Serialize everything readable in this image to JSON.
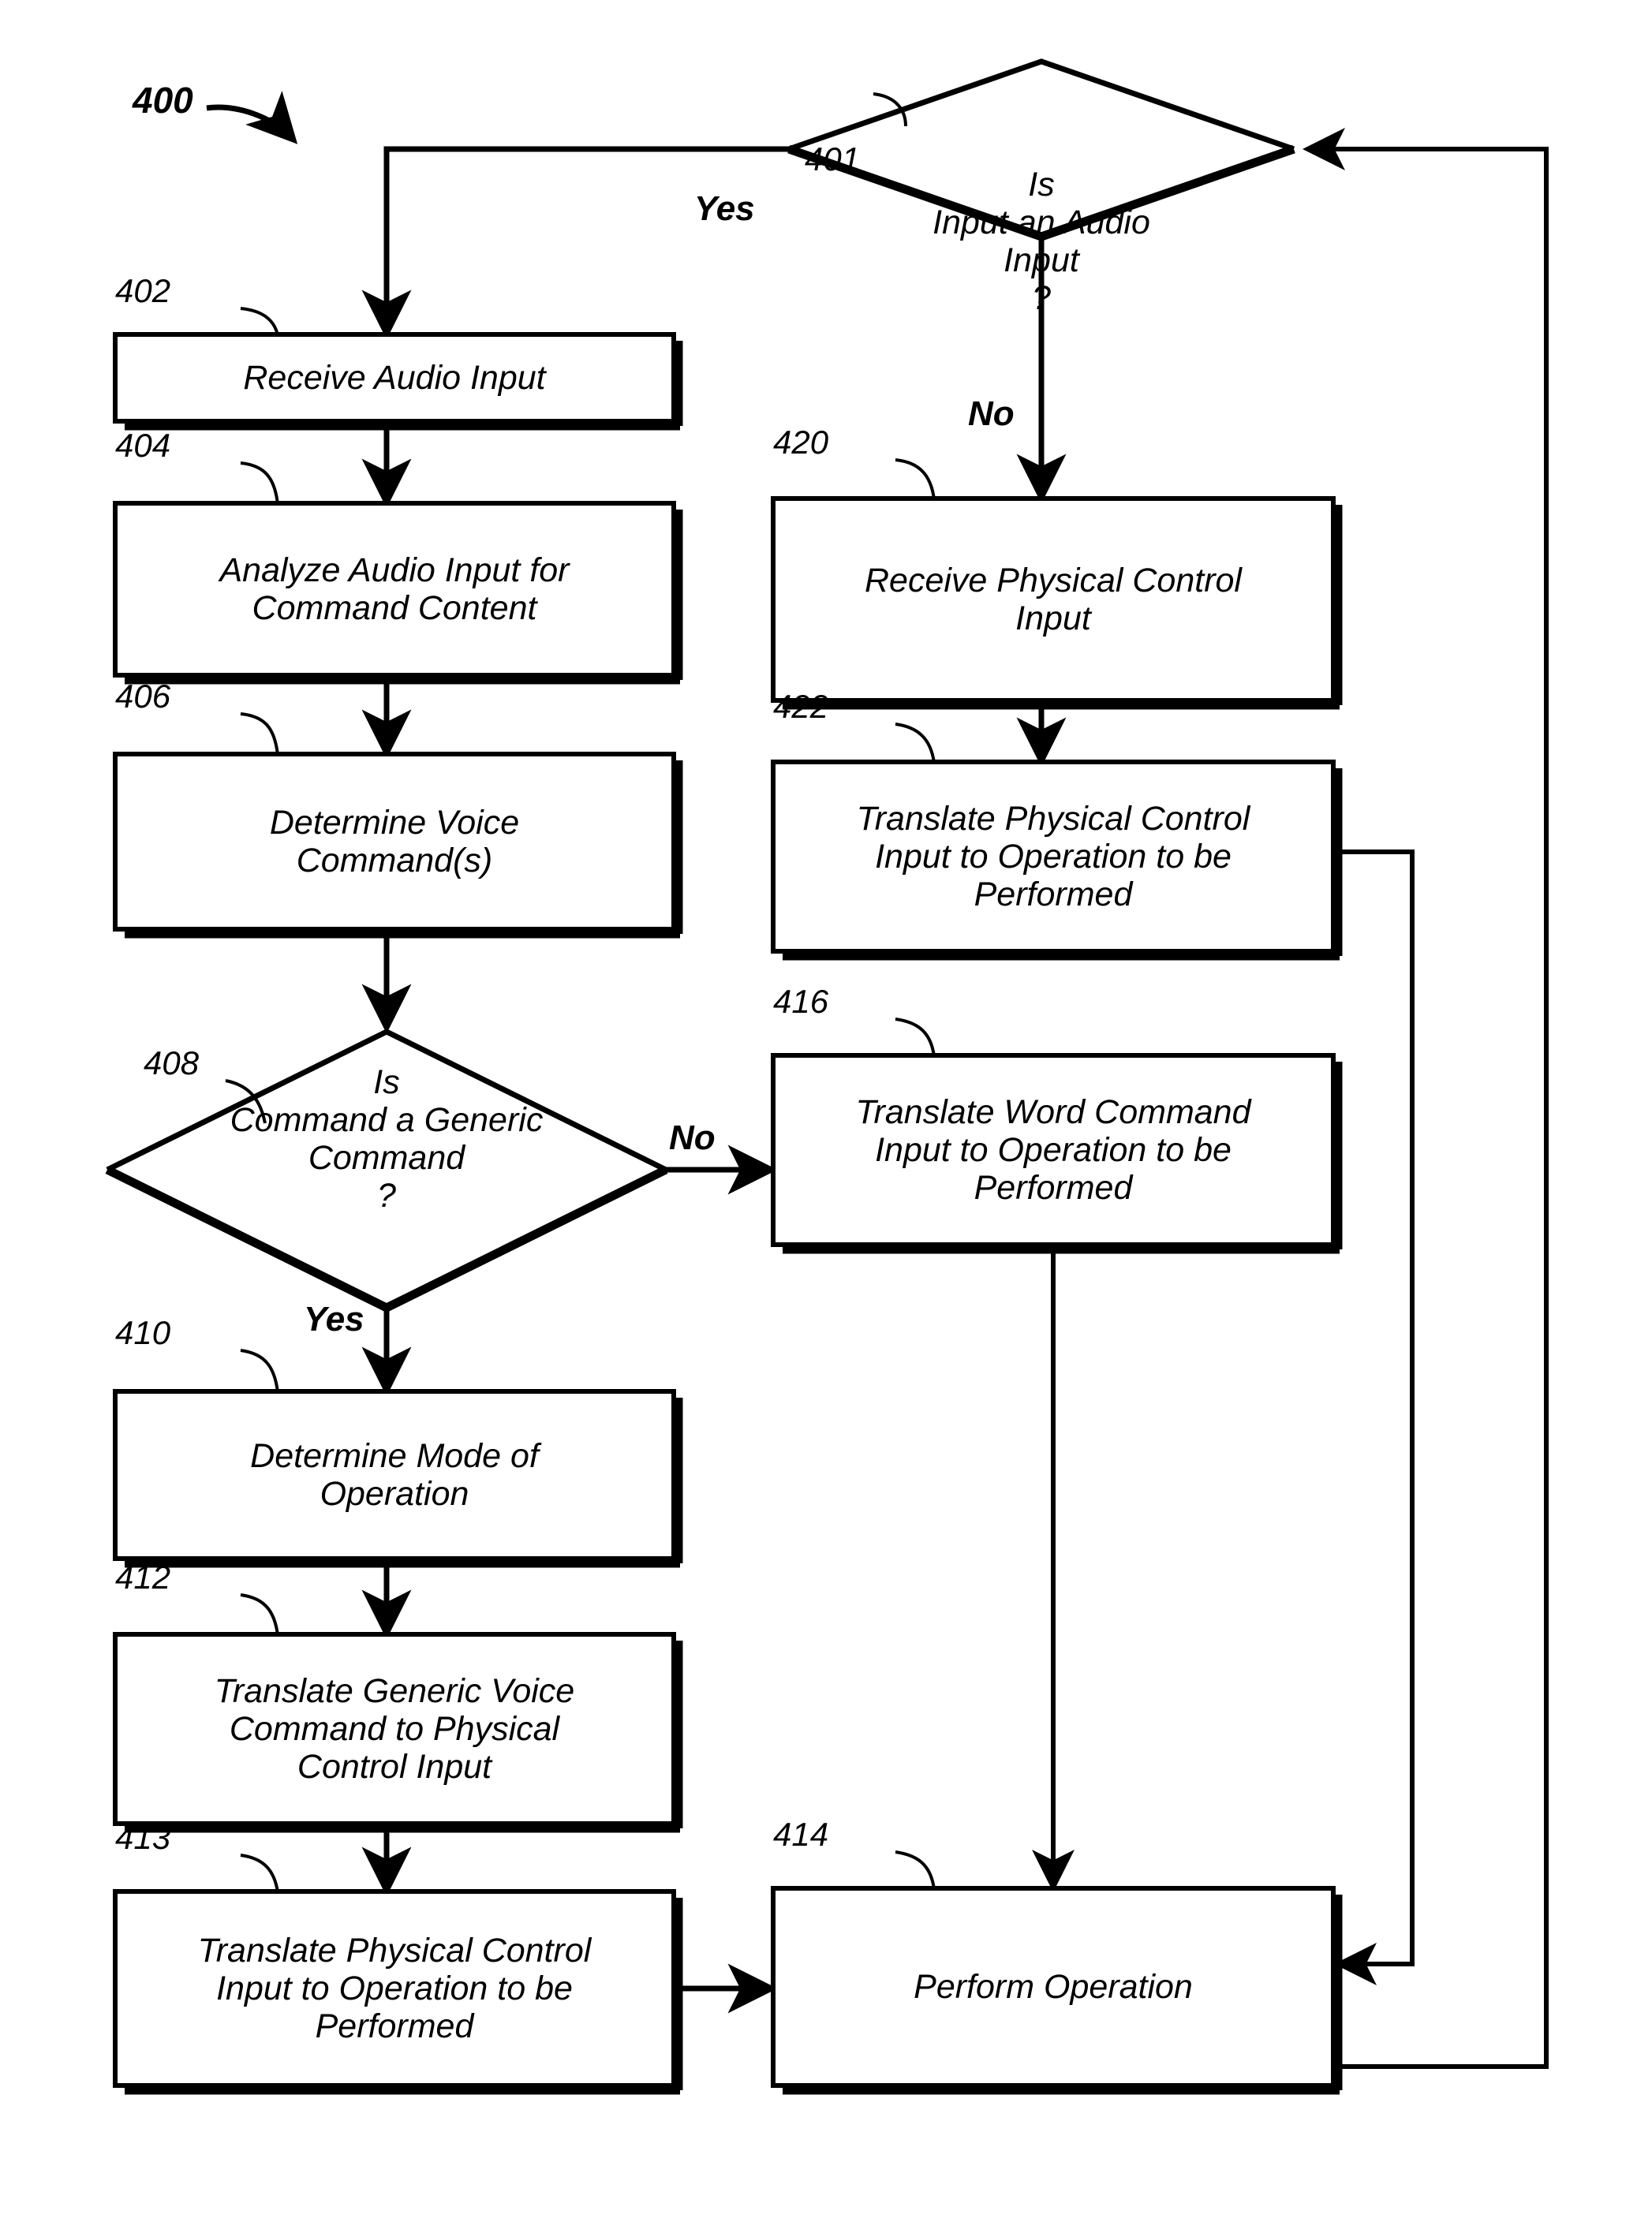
{
  "figure": {
    "number": "400",
    "type": "flowchart",
    "background_color": "#ffffff",
    "line_color": "#000000"
  },
  "nodes": {
    "d401": {
      "ref": "401",
      "shape": "diamond",
      "text": "Is\nInput an Audio\nInput\n?"
    },
    "b402": {
      "ref": "402",
      "shape": "rect",
      "text": "Receive Audio Input"
    },
    "b404": {
      "ref": "404",
      "shape": "rect",
      "text": "Analyze Audio Input for\nCommand Content"
    },
    "b406": {
      "ref": "406",
      "shape": "rect",
      "text": "Determine Voice\nCommand(s)"
    },
    "d408": {
      "ref": "408",
      "shape": "diamond",
      "text": "Is\nCommand a Generic\nCommand\n?"
    },
    "b410": {
      "ref": "410",
      "shape": "rect",
      "text": "Determine Mode of\nOperation"
    },
    "b412": {
      "ref": "412",
      "shape": "rect",
      "text": "Translate Generic Voice\nCommand to Physical\nControl Input"
    },
    "b413": {
      "ref": "413",
      "shape": "rect",
      "text": "Translate Physical Control\nInput to Operation to be\nPerformed"
    },
    "b414": {
      "ref": "414",
      "shape": "rect",
      "text": "Perform Operation"
    },
    "b416": {
      "ref": "416",
      "shape": "rect",
      "text": "Translate Word Command\nInput to Operation to be\nPerformed"
    },
    "b420": {
      "ref": "420",
      "shape": "rect",
      "text": "Receive Physical Control\nInput"
    },
    "b422": {
      "ref": "422",
      "shape": "rect",
      "text": "Translate Physical Control\nInput to Operation to be\nPerformed"
    }
  },
  "edge_labels": {
    "d401_yes": "Yes",
    "d401_no": "No",
    "d408_no": "No",
    "d408_yes": "Yes"
  },
  "edges": [
    {
      "from": "d401",
      "to": "b402",
      "label": "Yes"
    },
    {
      "from": "d401",
      "to": "b420",
      "label": "No"
    },
    {
      "from": "b402",
      "to": "b404",
      "label": ""
    },
    {
      "from": "b404",
      "to": "b406",
      "label": ""
    },
    {
      "from": "b406",
      "to": "d408",
      "label": ""
    },
    {
      "from": "d408",
      "to": "b416",
      "label": "No"
    },
    {
      "from": "d408",
      "to": "b410",
      "label": "Yes"
    },
    {
      "from": "b410",
      "to": "b412",
      "label": ""
    },
    {
      "from": "b412",
      "to": "b413",
      "label": ""
    },
    {
      "from": "b413",
      "to": "b414",
      "label": ""
    },
    {
      "from": "b416",
      "to": "b414",
      "label": ""
    },
    {
      "from": "b420",
      "to": "b422",
      "label": ""
    },
    {
      "from": "b422",
      "to": "b414",
      "label": ""
    },
    {
      "from": "b414",
      "to": "d401",
      "label": ""
    }
  ]
}
